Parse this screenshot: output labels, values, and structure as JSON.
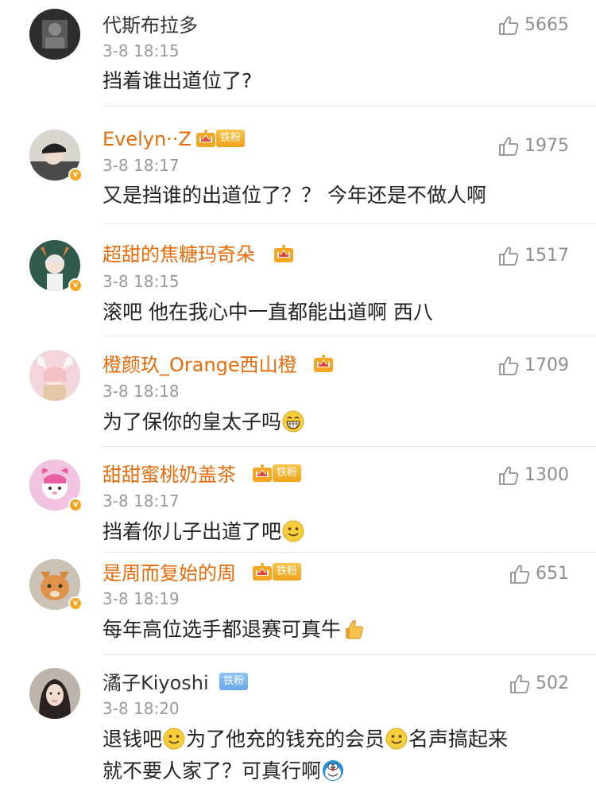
{
  "comments": [
    {
      "name": "代斯布拉多",
      "time": "3-8 18:15",
      "text": "挡着谁出道位了?",
      "likes": "5665",
      "vip": false,
      "crown": "",
      "fan": "",
      "verified": false
    },
    {
      "name": "Evelyn··Z",
      "time": "3-8 18:17",
      "text": "又是挡谁的出道位了？？ 今年还是不做人啊",
      "likes": "1975",
      "vip": true,
      "crown": "5",
      "fan": "铁粉",
      "verified": true
    },
    {
      "name": "超甜的焦糖玛奇朵",
      "time": "3-8 18:15",
      "text": "滚吧 他在我心中一直都能出道啊 西八",
      "likes": "1517",
      "vip": true,
      "crown": "5",
      "fan": "",
      "verified": true
    },
    {
      "name": "橙颜玖_Orange西山橙",
      "time": "3-8 18:18",
      "text": "为了保你的皇太子吗",
      "likes": "1709",
      "vip": true,
      "crown": "6",
      "fan": "",
      "verified": false
    },
    {
      "name": "甜甜蜜桃奶盖茶",
      "time": "3-8 18:17",
      "text": "挡着你儿子出道了吧",
      "likes": "1300",
      "vip": true,
      "crown": "6",
      "fan": "铁粉",
      "verified": true
    },
    {
      "name": "是周而复始的周",
      "time": "3-8 18:19",
      "text": "每年高位选手都退赛可真牛",
      "likes": "651",
      "vip": true,
      "crown": "6",
      "fan": "铁粉",
      "verified": true
    },
    {
      "name": "潏子Kiyoshi",
      "time": "3-8 18:20",
      "text_parts": [
        "退钱吧",
        "为了他充的钱充的会员",
        "名声搞起来",
        "就不要人家了？可真行啊"
      ],
      "likes": "502",
      "vip": false,
      "crown": "",
      "fan": "铁粉",
      "verified": false
    }
  ],
  "colors": {
    "vip_name": "#e86b0a",
    "regular_name": "#333333",
    "time": "#9a9a9a",
    "like": "#8f8f8f",
    "crown": "#f5a623",
    "verified": "#f5a623"
  },
  "icons": {
    "like": "thumbs-up-icon",
    "crown": "vip-crown-icon",
    "smile": "smile-emoji",
    "grin": "grin-emoji",
    "thumb_emoji": "thumbs-up-emoji",
    "doraemon": "doraemon-emoji"
  }
}
